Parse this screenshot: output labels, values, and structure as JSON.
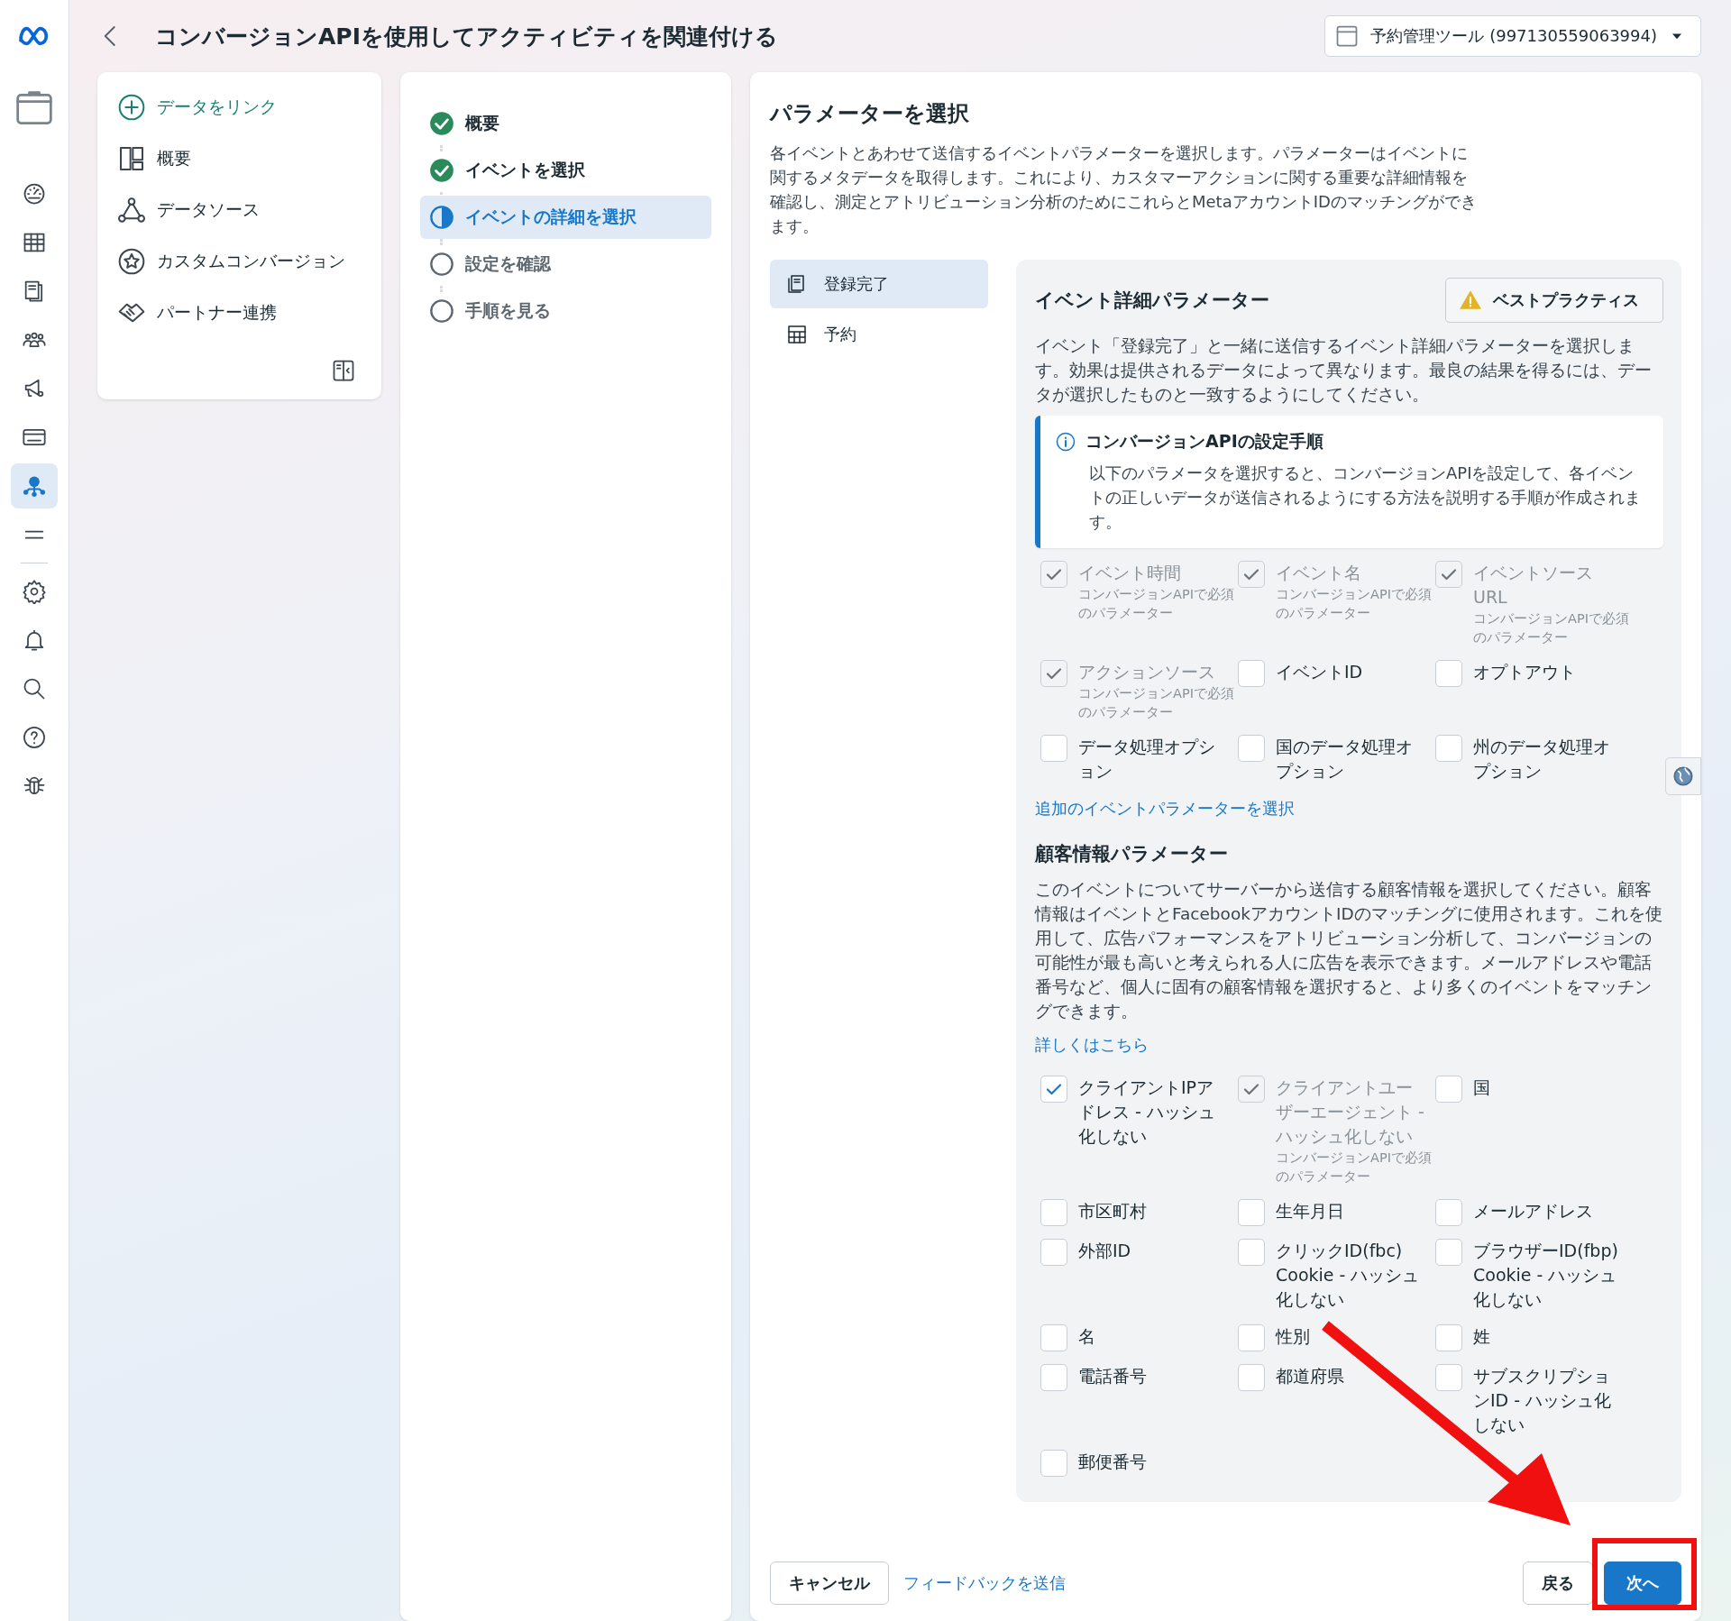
{
  "header": {
    "title": "コンバージョンAPIを使用してアクティビティを関連付ける",
    "account": "予約管理ツール (997130559063994)"
  },
  "rail": [
    {
      "selected": false
    },
    {
      "selected": false
    },
    {
      "selected": false
    },
    {
      "selected": false
    },
    {
      "selected": false
    },
    {
      "selected": false
    },
    {
      "selected": false
    },
    {
      "selected": true
    },
    {
      "selected": false
    },
    {
      "selected": false
    },
    {
      "selected": false
    },
    {
      "selected": false
    },
    {
      "selected": false
    },
    {
      "selected": false
    }
  ],
  "nav": [
    {
      "label": "データをリンク",
      "kind": "action"
    },
    {
      "label": "概要",
      "kind": "item"
    },
    {
      "label": "データソース",
      "kind": "item"
    },
    {
      "label": "カスタムコンバージョン",
      "kind": "item"
    },
    {
      "label": "パートナー連携",
      "kind": "item"
    }
  ],
  "steps": [
    {
      "label": "概要",
      "done": true,
      "selected": false
    },
    {
      "label": "イベントを選択",
      "done": true,
      "selected": false
    },
    {
      "label": "イベントの詳細を選択",
      "done": false,
      "selected": true
    },
    {
      "label": "設定を確認",
      "done": false,
      "selected": false
    },
    {
      "label": "手順を見る",
      "done": false,
      "selected": false
    }
  ],
  "main": {
    "title": "パラメーターを選択",
    "description": "各イベントとあわせて送信するイベントパラメーターを選択します。パラメーターはイベントに関するメタデータを取得します。これにより、カスタマーアクションに関する重要な詳細情報を確認し、測定とアトリビューション分析のためにこれらとMetaアカウントIDのマッチングができます。"
  },
  "events": [
    {
      "label": "登録完了",
      "selected": true
    },
    {
      "label": "予約",
      "selected": false
    }
  ],
  "event_params": {
    "title": "イベント詳細パラメーター",
    "best_practices": "ベストプラクティス",
    "description": "イベント「登録完了」と一緒に送信するイベント詳細パラメーターを選択します。効果は提供されるデータによって異なります。最良の結果を得るには、データが選択したものと一致するようにしてください。",
    "info": {
      "title": "コンバージョンAPIの設定手順",
      "text": "以下のパラメータを選択すると、コンバージョンAPIを設定して、各イベントの正しいデータが送信されるようにする方法を説明する手順が作成されます。"
    },
    "items": [
      {
        "label": "イベント時間",
        "note": "コンバージョンAPIで必須のパラメーター",
        "checked": true,
        "disabled": true
      },
      {
        "label": "イベント名",
        "note": "コンバージョンAPIで必須のパラメーター",
        "checked": true,
        "disabled": true
      },
      {
        "label": "イベントソースURL",
        "note": "コンバージョンAPIで必須のパラメーター",
        "checked": true,
        "disabled": true
      },
      {
        "label": "アクションソース",
        "note": "コンバージョンAPIで必須のパラメーター",
        "checked": true,
        "disabled": true
      },
      {
        "label": "イベントID",
        "checked": false,
        "disabled": false
      },
      {
        "label": "オプトアウト",
        "checked": false,
        "disabled": false
      },
      {
        "label": "データ処理オプション",
        "checked": false,
        "disabled": false
      },
      {
        "label": "国のデータ処理オプション",
        "checked": false,
        "disabled": false
      },
      {
        "label": "州のデータ処理オプション",
        "checked": false,
        "disabled": false
      }
    ],
    "more_link": "追加のイベントパラメーターを選択"
  },
  "customer_params": {
    "title": "顧客情報パラメーター",
    "description": "このイベントについてサーバーから送信する顧客情報を選択してください。顧客情報はイベントとFacebookアカウントIDのマッチングに使用されます。これを使用して、広告パフォーマンスをアトリビューション分析して、コンバージョンの可能性が最も高いと考えられる人に広告を表示できます。メールアドレスや電話番号など、個人に固有の顧客情報を選択すると、より多くのイベントをマッチングできます。",
    "learn_more": "詳しくはこちら",
    "items": [
      {
        "label": "クライアントIPアドレス - ハッシュ化しない",
        "checked": true,
        "disabled": false
      },
      {
        "label": "クライアントユーザーエージェント - ハッシュ化しない",
        "note": "コンバージョンAPIで必須のパラメーター",
        "checked": true,
        "disabled": true
      },
      {
        "label": "国",
        "checked": false,
        "disabled": false
      },
      {
        "label": "市区町村",
        "checked": false,
        "disabled": false
      },
      {
        "label": "生年月日",
        "checked": false,
        "disabled": false
      },
      {
        "label": "メールアドレス",
        "checked": false,
        "disabled": false
      },
      {
        "label": "外部ID",
        "checked": false,
        "disabled": false
      },
      {
        "label": "クリックID(fbc) Cookie - ハッシュ化しない",
        "checked": false,
        "disabled": false
      },
      {
        "label": "ブラウザーID(fbp) Cookie - ハッシュ化しない",
        "checked": false,
        "disabled": false
      },
      {
        "label": "名",
        "checked": false,
        "disabled": false
      },
      {
        "label": "性別",
        "checked": false,
        "disabled": false
      },
      {
        "label": "姓",
        "checked": false,
        "disabled": false
      },
      {
        "label": "電話番号",
        "checked": false,
        "disabled": false
      },
      {
        "label": "都道府県",
        "checked": false,
        "disabled": false
      },
      {
        "label": "サブスクリプションID - ハッシュ化しない",
        "checked": false,
        "disabled": false
      },
      {
        "label": "郵便番号",
        "checked": false,
        "disabled": false
      }
    ]
  },
  "footer": {
    "cancel": "キャンセル",
    "feedback": "フィードバックを送信",
    "back": "戻る",
    "next": "次へ"
  }
}
